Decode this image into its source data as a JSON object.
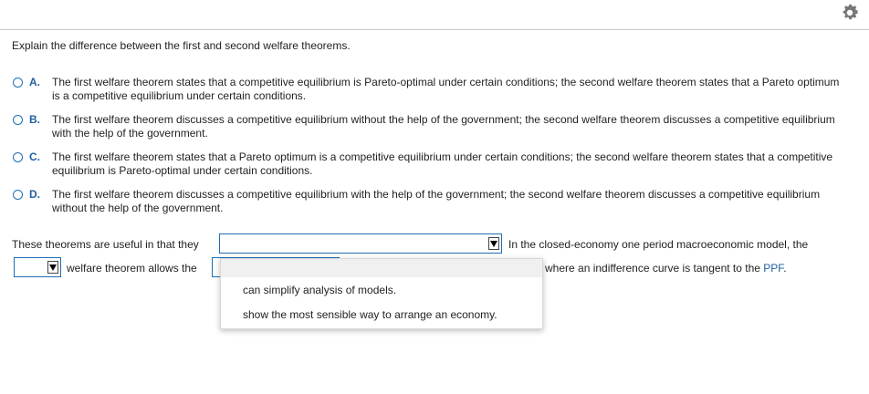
{
  "question": "Explain the difference between the first and second welfare theorems.",
  "options": [
    {
      "letter": "A.",
      "text": "The first welfare theorem states that a competitive equilibrium is Pareto-optimal under certain conditions; the second welfare theorem states that a Pareto optimum is a competitive equilibrium under certain conditions."
    },
    {
      "letter": "B.",
      "text": "The first welfare theorem discusses a competitive equilibrium without the help of the government; the second welfare theorem discusses a competitive equilibrium with the help of the government."
    },
    {
      "letter": "C.",
      "text": "The first welfare theorem states that a Pareto optimum is a competitive equilibrium under certain conditions; the second welfare theorem states that a competitive equilibrium is Pareto-optimal under certain conditions."
    },
    {
      "letter": "D.",
      "text": "The first welfare theorem discusses a competitive equilibrium with the help of the government; the second welfare theorem discusses a competitive equilibrium without the help of the government."
    }
  ],
  "fill": {
    "line1_prefix": "These theorems are useful in that they",
    "line1_suffix": "In the closed-economy one period macroeconomic model, the",
    "line2_mid": "welfare theorem allows the",
    "line2_suffix_pre": "where an indifference curve is tangent to the ",
    "line2_suffix_link": "PPF",
    "line2_suffix_end": "."
  },
  "dropdown_options": [
    "can simplify analysis of models.",
    "show the most sensible way to arrange an economy."
  ]
}
